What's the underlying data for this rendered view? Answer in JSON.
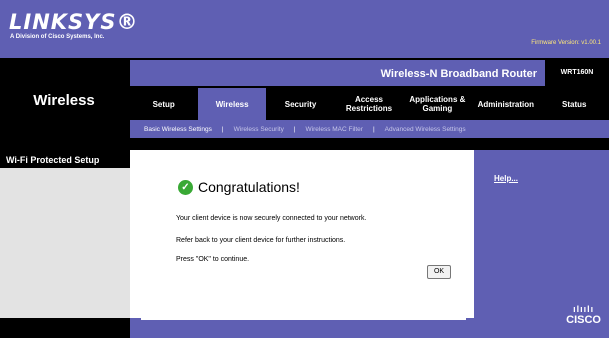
{
  "brand": {
    "logo": "LINKSYS®",
    "subtitle": "A Division of Cisco Systems, Inc.",
    "firmware": "Firmware Version: v1.00.1"
  },
  "section": {
    "title": "Wireless"
  },
  "product": {
    "name": "Wireless-N Broadband Router",
    "model": "WRT160N"
  },
  "tabs": [
    {
      "label": "Setup"
    },
    {
      "label": "Wireless"
    },
    {
      "label": "Security"
    },
    {
      "label": "Access Restrictions"
    },
    {
      "label": "Applications & Gaming"
    },
    {
      "label": "Administration"
    },
    {
      "label": "Status"
    }
  ],
  "subtabs": [
    {
      "label": "Basic Wireless Settings"
    },
    {
      "label": "Wireless Security"
    },
    {
      "label": "Wireless MAC Filter"
    },
    {
      "label": "Advanced Wireless Settings"
    }
  ],
  "sidebar": {
    "heading": "Wi-Fi Protected Setup"
  },
  "help": {
    "label": "Help..."
  },
  "dialog": {
    "title": "Congratulations!",
    "line1": "Your client device is now securely connected to your network.",
    "line2": "Refer back to your client device for further instructions.",
    "line3": "Press \"OK\" to continue.",
    "ok_label": "OK"
  },
  "footer": {
    "cisco_wordmark": "CISCO",
    "cisco_bars": "ılıılı"
  },
  "colors": {
    "brand_purple": "#5f5fb3",
    "band_black": "#000000",
    "check_green": "#39a935"
  },
  "icons": {
    "check": "check-circle-icon"
  }
}
